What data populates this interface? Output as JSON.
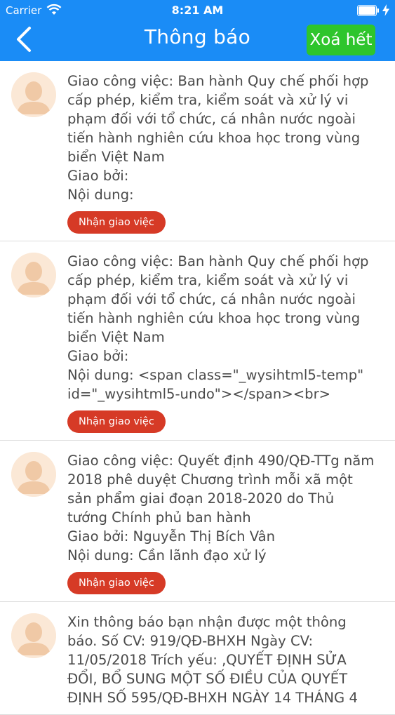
{
  "status_bar": {
    "carrier": "Carrier",
    "time": "8:21 AM"
  },
  "header": {
    "title": "Thông báo",
    "clear_all": "Xoá hết"
  },
  "colors": {
    "header": "#1a8cf6",
    "clear_button": "#2ec52c",
    "accept_button": "#d63a26"
  },
  "icons": {
    "back": "chevron-left-icon",
    "avatar": "user-avatar-icon",
    "wifi": "wifi-icon",
    "battery": "battery-icon"
  },
  "notifications": [
    {
      "lines": [
        "Giao công việc: Ban hành Quy chế phối hợp",
        "cấp phép, kiểm tra, kiểm soát và xử lý vi",
        "phạm đối với tổ chức, cá nhân nước ngoài",
        "tiến hành nghiên cứu khoa học trong vùng",
        "biển Việt Nam",
        "Giao bởi:",
        "Nội dung:"
      ],
      "button": "Nhận giao việc"
    },
    {
      "lines": [
        "Giao công việc: Ban hành Quy chế phối hợp",
        "cấp phép, kiểm tra, kiểm soát và xử lý vi",
        "phạm đối với tổ chức, cá nhân nước ngoài",
        "tiến hành nghiên cứu khoa học trong vùng",
        "biển Việt Nam",
        "Giao bởi:",
        "Nội dung: <span class=\"_wysihtml5-temp\"",
        "id=\"_wysihtml5-undo\"></span><br>"
      ],
      "button": "Nhận giao việc"
    },
    {
      "lines": [
        "Giao công việc: Quyết định 490/QĐ-TTg năm",
        "2018 phê duyệt Chương trình mỗi xã một",
        "sản phẩm giai đoạn 2018-2020 do Thủ",
        "tướng Chính phủ ban hành",
        "Giao bởi:  Nguyễn Thị Bích Vân",
        "Nội dung: Cần lãnh đạo xử lý"
      ],
      "button": "Nhận giao việc"
    },
    {
      "lines": [
        "Xin thông báo bạn nhận được một thông",
        "báo. Số CV: 919/QĐ-BHXH  Ngày CV:",
        "11/05/2018  Trích yếu: ,QUYẾT ĐỊNH SỬA",
        "ĐỔI, BỔ SUNG MỘT SỐ ĐIỀU CỦA QUYẾT",
        "ĐỊNH SỐ 595/QĐ-BHXH NGÀY 14 THÁNG 4"
      ],
      "button": ""
    }
  ]
}
